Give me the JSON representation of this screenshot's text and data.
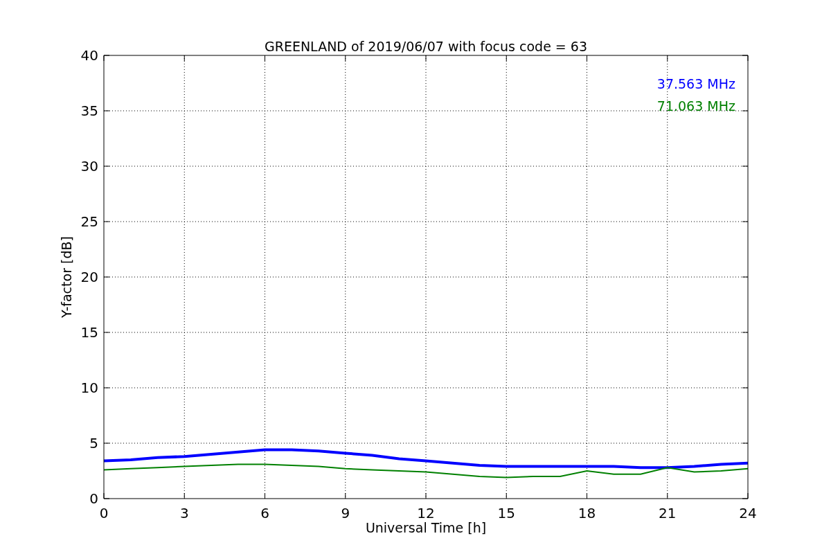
{
  "figure": {
    "chart_data": {
      "type": "line",
      "title": "GREENLAND of 2019/06/07 with focus code = 63",
      "xlabel": "Universal Time [h]",
      "ylabel": "Y-factor [dB]",
      "x": [
        0,
        1,
        2,
        3,
        4,
        5,
        6,
        7,
        8,
        9,
        10,
        11,
        12,
        13,
        14,
        15,
        16,
        17,
        18,
        19,
        20,
        21,
        22,
        23,
        24
      ],
      "series": [
        {
          "name": "37.563 MHz",
          "color": "#0000ff",
          "values": [
            3.4,
            3.5,
            3.7,
            3.8,
            4.0,
            4.2,
            4.4,
            4.4,
            4.3,
            4.1,
            3.9,
            3.6,
            3.4,
            3.2,
            3.0,
            2.9,
            2.9,
            2.9,
            2.9,
            2.9,
            2.8,
            2.8,
            2.9,
            3.1,
            3.2
          ]
        },
        {
          "name": "71.063 MHz",
          "color": "#008000",
          "values": [
            2.6,
            2.7,
            2.8,
            2.9,
            3.0,
            3.1,
            3.1,
            3.0,
            2.9,
            2.7,
            2.6,
            2.5,
            2.4,
            2.2,
            2.0,
            1.9,
            2.0,
            2.0,
            2.5,
            2.2,
            2.2,
            2.8,
            2.4,
            2.5,
            2.7
          ]
        }
      ],
      "xlim": [
        0,
        24
      ],
      "ylim": [
        0,
        40
      ],
      "grid": true,
      "xticks": [
        0,
        3,
        6,
        9,
        12,
        15,
        18,
        21,
        24
      ],
      "yticks": [
        0,
        5,
        10,
        15,
        20,
        25,
        30,
        35,
        40
      ]
    }
  }
}
